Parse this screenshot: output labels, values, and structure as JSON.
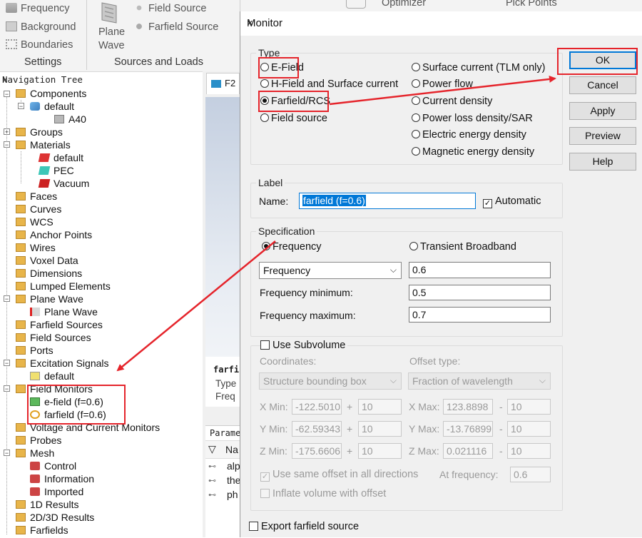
{
  "ribbon": {
    "settings_items": [
      "Frequency",
      "Background",
      "Boundaries"
    ],
    "settings_label": "Settings",
    "plane_wave": [
      "Plane",
      "Wave"
    ],
    "sources_items": [
      "Field Source",
      "Farfield Source"
    ],
    "sources_label": "Sources and Loads",
    "top_items": [
      "Optimizer",
      "Pick Points"
    ]
  },
  "nav": {
    "title": "Navigation Tree",
    "close": "×",
    "items": [
      "Components",
      "default",
      "A40",
      "Groups",
      "Materials",
      "default",
      "PEC",
      "Vacuum",
      "Faces",
      "Curves",
      "WCS",
      "Anchor Points",
      "Wires",
      "Voxel Data",
      "Dimensions",
      "Lumped Elements",
      "Plane Wave",
      "Plane Wave",
      "Farfield Sources",
      "Field Sources",
      "Ports",
      "Excitation Signals",
      "default",
      "Field Monitors",
      "e-field (f=0.6)",
      "farfield (f=0.6)",
      "Voltage and Current Monitors",
      "Probes",
      "Mesh",
      "Control",
      "Information",
      "Imported",
      "1D Results",
      "2D/3D Results",
      "Farfields"
    ]
  },
  "midpane": {
    "tab": "F2",
    "info": [
      "farfi",
      "Type",
      "Freq"
    ],
    "param_title": "Parame",
    "param_header": "Na",
    "params": [
      "alp",
      "the",
      "ph"
    ]
  },
  "dialog": {
    "title": "Monitor",
    "close": "×",
    "type_legend": "Type",
    "type_options": [
      "E-Field",
      "H-Field and Surface current",
      "Farfield/RCS",
      "Field source",
      "Surface current (TLM only)",
      "Power flow",
      "Current density",
      "Power loss density/SAR",
      "Electric energy density",
      "Magnetic energy density"
    ],
    "label_legend": "Label",
    "name_label": "Name:",
    "name_value": "farfield (f=0.6)",
    "automatic": "Automatic",
    "spec_legend": "Specification",
    "spec_freq": "Frequency",
    "spec_transient": "Transient Broadband",
    "freq_select": "Frequency",
    "freq_value": "0.6",
    "freq_min_label": "Frequency minimum:",
    "freq_min": "0.5",
    "freq_max_label": "Frequency maximum:",
    "freq_max": "0.7",
    "subvolume": {
      "label": "Use Subvolume",
      "coords_label": "Coordinates:",
      "coords_value": "Structure bounding box",
      "offset_label": "Offset type:",
      "offset_value": "Fraction of wavelength",
      "xmin_label": "X Min:",
      "xmin": "-122.5010",
      "ymin_label": "Y Min:",
      "ymin": "-62.59343",
      "zmin_label": "Z Min:",
      "zmin": "-175.6606",
      "xmax_label": "X Max:",
      "xmax": "123.8898",
      "ymax_label": "Y Max:",
      "ymax": "-13.76899",
      "zmax_label": "Z Max:",
      "zmax": "0.021116",
      "offset_num": "10",
      "plus": "+",
      "minus": "-",
      "same_offset": "Use same offset in all directions",
      "at_freq_label": "At frequency:",
      "at_freq": "0.6",
      "inflate": "Inflate volume with offset"
    },
    "export": "Export farfield source",
    "buttons": [
      "OK",
      "Cancel",
      "Apply",
      "Preview",
      "Help"
    ]
  },
  "colors": {
    "annotation": "#e5242b",
    "accent": "#0078d7"
  }
}
